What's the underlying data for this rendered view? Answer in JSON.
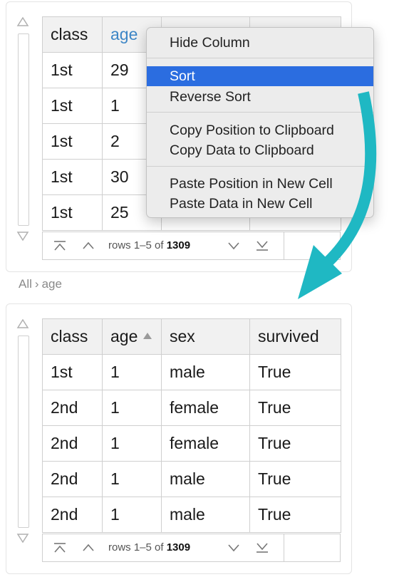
{
  "top_panel": {
    "columns": [
      "class",
      "age",
      "",
      ""
    ],
    "rows": [
      [
        "1st",
        "29"
      ],
      [
        "1st",
        "1"
      ],
      [
        "1st",
        "2"
      ],
      [
        "1st",
        "30"
      ],
      [
        "1st",
        "25"
      ]
    ],
    "pager": {
      "rows_prefix": "rows 1–5 of ",
      "total": "1309"
    }
  },
  "context_menu": {
    "items": [
      "Hide Column",
      "Sort",
      "Reverse Sort",
      "Copy Position to Clipboard",
      "Copy Data to Clipboard",
      "Paste Position in New Cell",
      "Paste Data in New Cell"
    ],
    "selected": "Sort",
    "highlight_color": "#2b6de0"
  },
  "breadcrumb": {
    "root": "All",
    "separator": "›",
    "current": "age"
  },
  "bottom_panel": {
    "columns": [
      "class",
      "age",
      "sex",
      "survived"
    ],
    "rows": [
      [
        "1st",
        "1",
        "male",
        "True"
      ],
      [
        "2nd",
        "1",
        "female",
        "True"
      ],
      [
        "2nd",
        "1",
        "female",
        "True"
      ],
      [
        "2nd",
        "1",
        "male",
        "True"
      ],
      [
        "2nd",
        "1",
        "male",
        "True"
      ]
    ],
    "sorted_column": "age",
    "pager": {
      "rows_prefix": "rows 1–5 of ",
      "total": "1309"
    }
  },
  "colors": {
    "arrow": "#1fb8c3",
    "header_blue": "#3d86c6"
  }
}
